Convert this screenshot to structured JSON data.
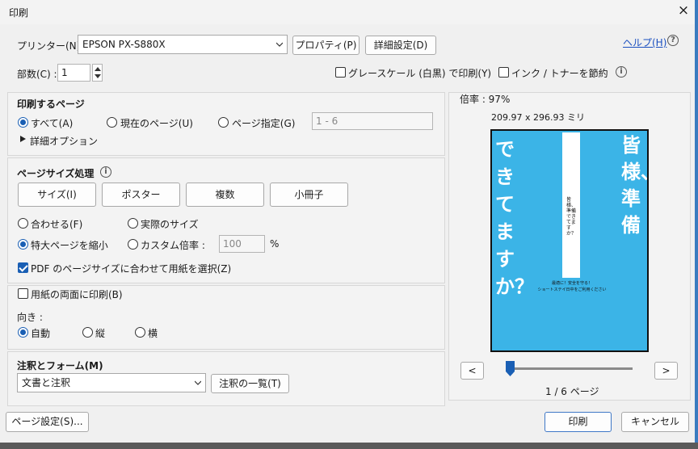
{
  "window": {
    "title": "印刷",
    "close": "×"
  },
  "header": {
    "printer_label": "プリンター(N) :",
    "printer_value": "EPSON PX-S880X",
    "properties_button": "プロパティ(P)",
    "advanced_button": "詳細設定(D)",
    "help_link": "ヘルプ(H)",
    "copies_label": "部数(C) :",
    "copies_value": "1",
    "grayscale_label": "グレースケール (白黒) で印刷(Y)",
    "save_ink_label": "インク / トナーを節約"
  },
  "pages_section": {
    "title": "印刷するページ",
    "all_label": "すべて(A)",
    "current_label": "現在のページ(U)",
    "range_label": "ページ指定(G)",
    "range_value": "1 - 6",
    "more_options": "詳細オプション"
  },
  "size_section": {
    "title": "ページサイズ処理",
    "buttons": [
      "サイズ(I)",
      "ポスター",
      "複数",
      "小冊子"
    ],
    "fit_label": "合わせる(F)",
    "actual_label": "実際のサイズ",
    "shrink_label": "特大ページを縮小",
    "custom_label": "カスタム倍率 :",
    "custom_value": "100",
    "percent": "%",
    "pdf_paper_label": "PDF のページサイズに合わせて用紙を選択(Z)"
  },
  "duplex_section": {
    "duplex_label": "用紙の両面に印刷(B)",
    "orientation_label": "向き :",
    "auto_label": "自動",
    "portrait_label": "縦",
    "landscape_label": "横"
  },
  "comments_section": {
    "title": "注釈とフォーム(M)",
    "select_value": "文書と注釈",
    "summary_button": "注釈の一覧(T)"
  },
  "preview": {
    "scale": "倍率 : 97%",
    "dimensions": "209.97 x 296.93 ミリ",
    "page_big_left": "できてますか？",
    "page_big_right": "皆様、準備",
    "page_strip_text": "皆様、準備できてますか？",
    "page_small_1": "最適に！安全を守る！",
    "page_small_2": "ショートステイ日中をご利用ください",
    "prev_button": "<",
    "next_button": ">",
    "page_indicator": "1 / 6 ページ",
    "slider_position": 0.0,
    "page_bg_color": "#3bb4e7"
  },
  "footer": {
    "page_setup_button": "ページ設定(S)...",
    "print_button": "印刷",
    "cancel_button": "キャンセル"
  }
}
